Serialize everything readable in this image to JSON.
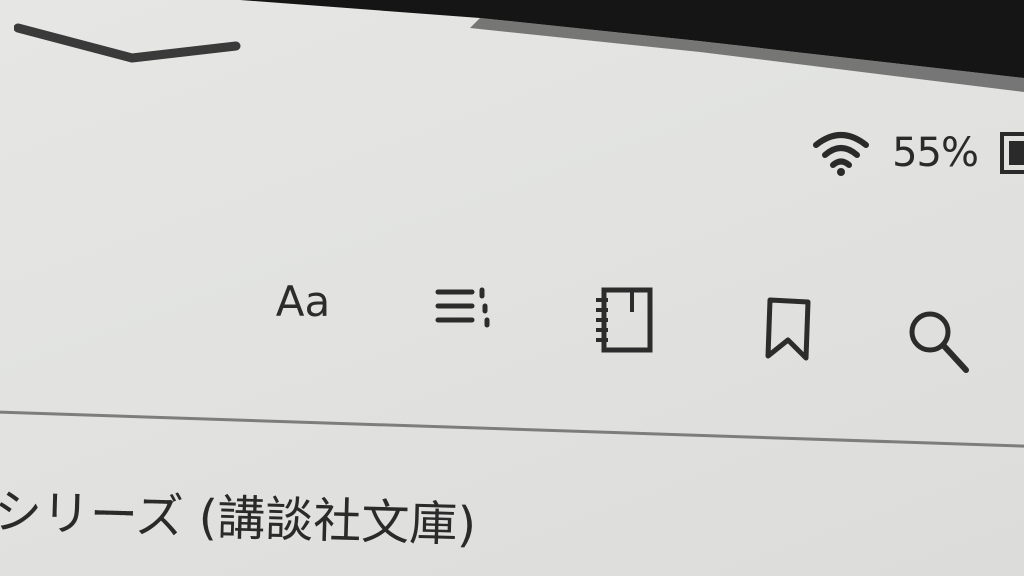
{
  "status": {
    "battery_percent": "55%",
    "wifi_icon": "wifi-icon",
    "battery_icon": "battery-icon"
  },
  "toolbar": {
    "font_label": "Aa",
    "icons": [
      "font-settings",
      "table-of-contents-icon",
      "notebook-icon",
      "bookmark-icon",
      "search-icon"
    ]
  },
  "content": {
    "title_fragment": "シリーズ (講談社文庫)"
  },
  "colors": {
    "background": "#e3e3e1",
    "ink": "#2a2a2a",
    "divider": "#7d7d7b"
  }
}
